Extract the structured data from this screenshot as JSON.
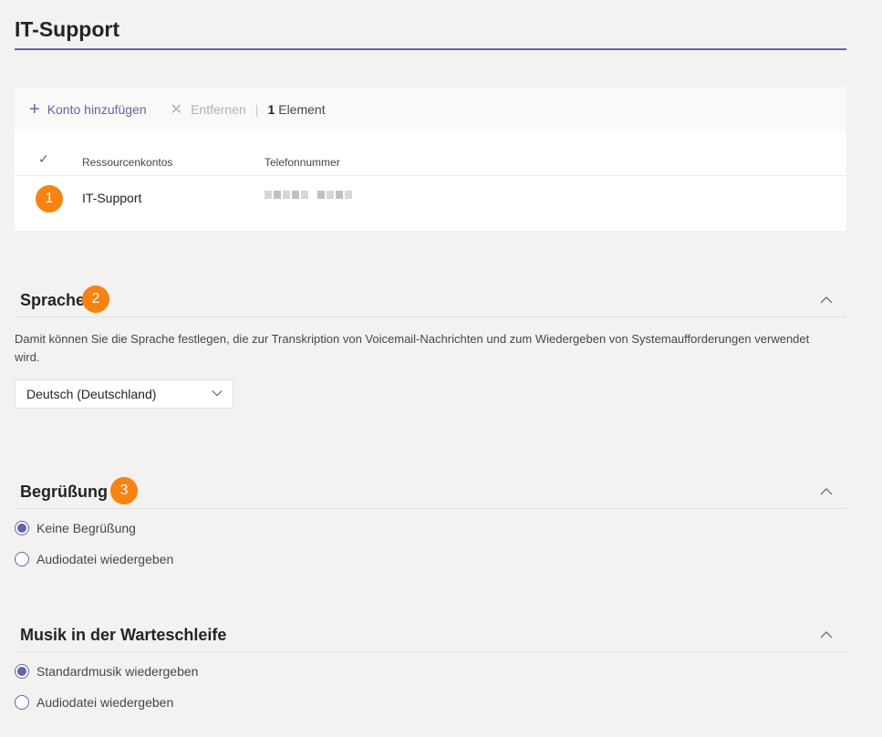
{
  "page": {
    "title": "IT-Support"
  },
  "toolbar": {
    "add_label": "Konto hinzufügen",
    "remove_label": "Entfernen",
    "separator": "|",
    "count_number": "1",
    "count_label": "Element"
  },
  "table": {
    "check_header": "✓",
    "columns": [
      "Ressourcenkontos",
      "Telefonnummer"
    ],
    "rows": [
      {
        "account": "IT-Support",
        "phone_redacted": true
      }
    ]
  },
  "badges": [
    "1",
    "2",
    "3"
  ],
  "language": {
    "title": "Sprache",
    "description": "Damit können Sie die Sprache festlegen, die zur Transkription von Voicemail-Nachrichten und zum Wiedergeben von Systemaufforderungen verwendet wird.",
    "selected": "Deutsch (Deutschland)"
  },
  "greeting": {
    "title": "Begrüßung",
    "options": [
      {
        "label": "Keine Begrüßung",
        "selected": true
      },
      {
        "label": "Audiodatei wiedergeben",
        "selected": false
      }
    ]
  },
  "hold_music": {
    "title": "Musik in der Warteschleife",
    "options": [
      {
        "label": "Standardmusik wiedergeben",
        "selected": true
      },
      {
        "label": "Audiodatei wiedergeben",
        "selected": false
      }
    ]
  },
  "colors": {
    "accent": "#6264a7",
    "badge": "#f7820f",
    "background": "#f3f2f1"
  },
  "icons": {
    "add": "plus-icon",
    "remove": "close-icon",
    "collapse": "chevron-up-icon",
    "dropdown": "chevron-down-icon"
  }
}
